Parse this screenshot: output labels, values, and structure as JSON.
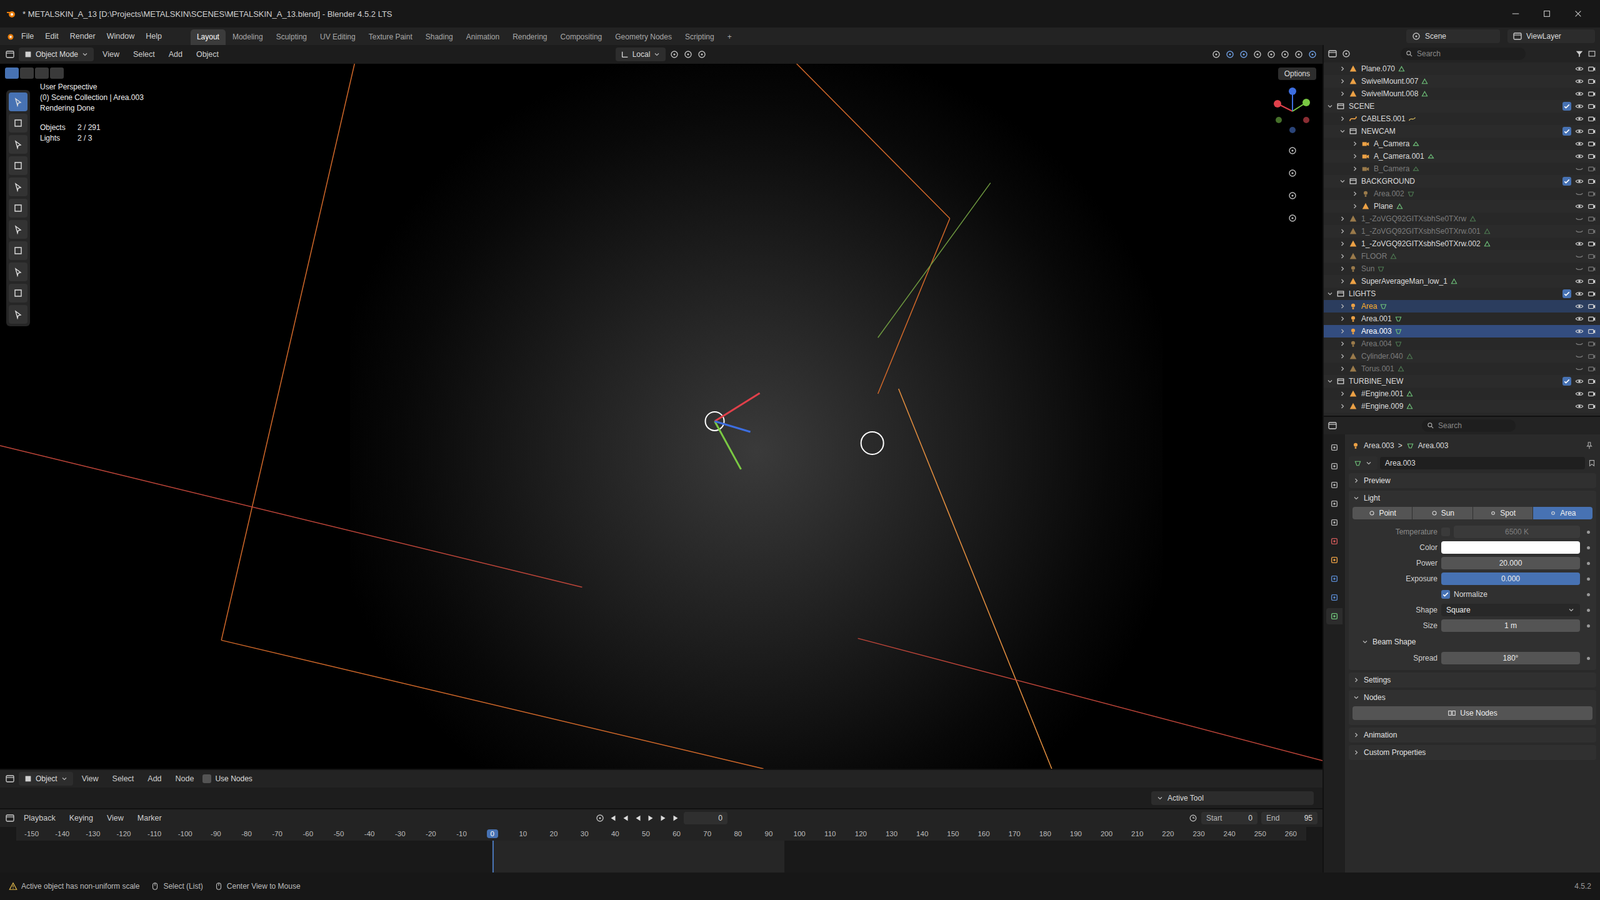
{
  "window": {
    "title": "* METALSKIN_A_13 [D:\\Projects\\METALSKIN\\SCENES\\METALSKIN_A_13.blend] - Blender 4.5.2 LTS"
  },
  "menu": [
    "File",
    "Edit",
    "Render",
    "Window",
    "Help"
  ],
  "workspaces": [
    {
      "label": "Layout",
      "selected": true
    },
    {
      "label": "Modeling",
      "selected": false
    },
    {
      "label": "Sculpting",
      "selected": false
    },
    {
      "label": "UV Editing",
      "selected": false
    },
    {
      "label": "Texture Paint",
      "selected": false
    },
    {
      "label": "Shading",
      "selected": false
    },
    {
      "label": "Animation",
      "selected": false
    },
    {
      "label": "Rendering",
      "selected": false
    },
    {
      "label": "Compositing",
      "selected": false
    },
    {
      "label": "Geometry Nodes",
      "selected": false
    },
    {
      "label": "Scripting",
      "selected": false
    }
  ],
  "add_workspace": "+",
  "scene": "Scene",
  "view_layer": "ViewLayer",
  "viewport": {
    "mode": "Object Mode",
    "menus": [
      "View",
      "Select",
      "Add",
      "Object"
    ],
    "transform_orientation": "Local",
    "options": "Options",
    "info": [
      "User Perspective",
      "(0) Scene Collection | Area.003",
      "Rendering Done"
    ],
    "stats": [
      {
        "label": "Objects",
        "value": "2 / 291"
      },
      {
        "label": "Lights",
        "value": "2 / 3"
      }
    ]
  },
  "outliner": {
    "search": "Search",
    "rows": [
      {
        "name": "Plane.070",
        "depth": 1,
        "kind": "mesh",
        "expanded": false,
        "visible": true,
        "selected": false,
        "active": false
      },
      {
        "name": "SwivelMount.007",
        "depth": 1,
        "kind": "mesh",
        "expanded": false,
        "visible": true,
        "selected": false,
        "active": false
      },
      {
        "name": "SwivelMount.008",
        "depth": 1,
        "kind": "mesh",
        "expanded": false,
        "visible": true,
        "selected": false,
        "active": false
      },
      {
        "name": "SCENE",
        "depth": 0,
        "kind": "collection",
        "expanded": true,
        "visible": true,
        "selected": false,
        "active": false
      },
      {
        "name": "CABLES.001",
        "depth": 1,
        "kind": "curve",
        "expanded": false,
        "visible": true,
        "selected": false,
        "active": false
      },
      {
        "name": "NEWCAM",
        "depth": 1,
        "kind": "collection",
        "expanded": true,
        "visible": true,
        "selected": false,
        "active": false
      },
      {
        "name": "A_Camera",
        "depth": 2,
        "kind": "camera",
        "expanded": false,
        "visible": true,
        "selected": false,
        "active": false
      },
      {
        "name": "A_Camera.001",
        "depth": 2,
        "kind": "camera",
        "expanded": false,
        "visible": true,
        "selected": false,
        "active": false
      },
      {
        "name": "B_Camera",
        "depth": 2,
        "kind": "camera",
        "expanded": false,
        "visible": false,
        "selected": false,
        "active": false
      },
      {
        "name": "BACKGROUND",
        "depth": 1,
        "kind": "collection",
        "expanded": true,
        "visible": true,
        "selected": false,
        "active": false
      },
      {
        "name": "Area.002",
        "depth": 2,
        "kind": "light",
        "expanded": false,
        "visible": false,
        "selected": false,
        "active": false
      },
      {
        "name": "Plane",
        "depth": 2,
        "kind": "mesh",
        "expanded": false,
        "visible": true,
        "selected": false,
        "active": false
      },
      {
        "name": "1_-ZoVGQ92GITXsbhSe0TXrw",
        "depth": 1,
        "kind": "mesh",
        "expanded": false,
        "visible": false,
        "selected": false,
        "active": false
      },
      {
        "name": "1_-ZoVGQ92GITXsbhSe0TXrw.001",
        "depth": 1,
        "kind": "mesh",
        "expanded": false,
        "visible": false,
        "selected": false,
        "active": false
      },
      {
        "name": "1_-ZoVGQ92GITXsbhSe0TXrw.002",
        "depth": 1,
        "kind": "mesh",
        "expanded": false,
        "visible": true,
        "selected": false,
        "active": false
      },
      {
        "name": "FLOOR",
        "depth": 1,
        "kind": "mesh",
        "expanded": false,
        "visible": false,
        "selected": false,
        "active": false
      },
      {
        "name": "Sun",
        "depth": 1,
        "kind": "light",
        "expanded": false,
        "visible": false,
        "selected": false,
        "active": false
      },
      {
        "name": "SuperAverageMan_low_1",
        "depth": 1,
        "kind": "mesh",
        "expanded": false,
        "visible": true,
        "selected": false,
        "active": false
      },
      {
        "name": "LIGHTS",
        "depth": 0,
        "kind": "collection",
        "expanded": true,
        "visible": true,
        "selected": false,
        "active": false
      },
      {
        "name": "Area",
        "depth": 1,
        "kind": "light",
        "expanded": false,
        "visible": true,
        "selected": true,
        "active": false
      },
      {
        "name": "Area.001",
        "depth": 1,
        "kind": "light",
        "expanded": false,
        "visible": true,
        "selected": false,
        "active": false
      },
      {
        "name": "Area.003",
        "depth": 1,
        "kind": "light",
        "expanded": false,
        "visible": true,
        "selected": true,
        "active": true
      },
      {
        "name": "Area.004",
        "depth": 1,
        "kind": "light",
        "expanded": false,
        "visible": false,
        "selected": false,
        "active": false
      },
      {
        "name": "Cylinder.040",
        "depth": 1,
        "kind": "mesh",
        "expanded": false,
        "visible": false,
        "selected": false,
        "active": false
      },
      {
        "name": "Torus.001",
        "depth": 1,
        "kind": "mesh",
        "expanded": false,
        "visible": false,
        "selected": false,
        "active": false
      },
      {
        "name": "TURBINE_NEW",
        "depth": 0,
        "kind": "collection",
        "expanded": true,
        "visible": true,
        "selected": false,
        "active": false
      },
      {
        "name": "#Engine.001",
        "depth": 1,
        "kind": "mesh",
        "expanded": false,
        "visible": true,
        "selected": false,
        "active": false
      },
      {
        "name": "#Engine.009",
        "depth": 1,
        "kind": "mesh",
        "expanded": false,
        "visible": true,
        "selected": false,
        "active": false
      }
    ]
  },
  "properties": {
    "search": "Search",
    "tabs": [
      {
        "kind": "tool",
        "selected": false
      },
      {
        "kind": "render",
        "selected": false
      },
      {
        "kind": "output",
        "selected": false
      },
      {
        "kind": "view_layer",
        "selected": false
      },
      {
        "kind": "scene",
        "selected": false
      },
      {
        "kind": "world",
        "selected": false
      },
      {
        "kind": "object",
        "selected": false
      },
      {
        "kind": "physics",
        "selected": false
      },
      {
        "kind": "constraints",
        "selected": false
      },
      {
        "kind": "data",
        "selected": true
      }
    ],
    "breadcrumb": [
      "Area.003",
      "Area.003"
    ],
    "separator": ">",
    "datablock": "Area.003",
    "panels": [
      {
        "title": "Preview",
        "expanded": false
      },
      {
        "title": "Light",
        "expanded": true,
        "types": [
          {
            "label": "Point",
            "selected": false
          },
          {
            "label": "Sun",
            "selected": false
          },
          {
            "label": "Spot",
            "selected": false
          },
          {
            "label": "Area",
            "selected": true
          }
        ],
        "fields": [
          {
            "kind": "slider",
            "label": "Temperature",
            "value": "6500 K",
            "disabled": true,
            "toggle": true,
            "checked": false,
            "level": 0
          },
          {
            "kind": "color",
            "label": "Color",
            "value": "#ffffff",
            "disabled": false
          },
          {
            "kind": "number",
            "label": "Power",
            "value": "20.000",
            "disabled": false
          },
          {
            "kind": "slider",
            "label": "Exposure",
            "value": "0.000",
            "disabled": false,
            "level": 1
          },
          {
            "kind": "checkbox",
            "label": "Normalize",
            "checked": true,
            "disabled": false
          },
          {
            "kind": "dropdown",
            "label": "Shape",
            "value": "Square",
            "disabled": false
          },
          {
            "kind": "number",
            "label": "Size",
            "value": "1 m",
            "disabled": false
          }
        ],
        "subpanels": [
          {
            "title": "Beam Shape",
            "expanded": true,
            "fields": [
              {
                "kind": "number",
                "label": "Spread",
                "value": "180°",
                "disabled": false
              }
            ]
          }
        ]
      },
      {
        "title": "Settings",
        "expanded": false
      },
      {
        "title": "Nodes",
        "expanded": true,
        "button": "Use Nodes"
      },
      {
        "title": "Animation",
        "expanded": false
      },
      {
        "title": "Custom Properties",
        "expanded": false
      }
    ]
  },
  "node_editor": {
    "mode": "Object",
    "menus": [
      "View",
      "Select",
      "Add",
      "Node"
    ],
    "use_nodes": {
      "label": "Use Nodes",
      "checked": false
    },
    "active_tool": {
      "label": "Active Tool",
      "expanded": true
    }
  },
  "timeline": {
    "menus": [
      "Playback",
      "Keying",
      "View",
      "Marker"
    ],
    "current_frame": "0",
    "start": {
      "label": "Start",
      "value": "0"
    },
    "end": {
      "label": "End",
      "value": "95"
    },
    "ruler": [
      {
        "label": "-150",
        "current": false
      },
      {
        "label": "-140",
        "current": false
      },
      {
        "label": "-130",
        "current": false
      },
      {
        "label": "-120",
        "current": false
      },
      {
        "label": "-110",
        "current": false
      },
      {
        "label": "-100",
        "current": false
      },
      {
        "label": "-90",
        "current": false
      },
      {
        "label": "-80",
        "current": false
      },
      {
        "label": "-70",
        "current": false
      },
      {
        "label": "-60",
        "current": false
      },
      {
        "label": "-50",
        "current": false
      },
      {
        "label": "-40",
        "current": false
      },
      {
        "label": "-30",
        "current": false
      },
      {
        "label": "-20",
        "current": false
      },
      {
        "label": "-10",
        "current": false
      },
      {
        "label": "0",
        "current": true
      },
      {
        "label": "10",
        "current": false
      },
      {
        "label": "20",
        "current": false
      },
      {
        "label": "30",
        "current": false
      },
      {
        "label": "40",
        "current": false
      },
      {
        "label": "50",
        "current": false
      },
      {
        "label": "60",
        "current": false
      },
      {
        "label": "70",
        "current": false
      },
      {
        "label": "80",
        "current": false
      },
      {
        "label": "90",
        "current": false
      },
      {
        "label": "100",
        "current": false
      },
      {
        "label": "110",
        "current": false
      },
      {
        "label": "120",
        "current": false
      },
      {
        "label": "130",
        "current": false
      },
      {
        "label": "140",
        "current": false
      },
      {
        "label": "150",
        "current": false
      },
      {
        "label": "160",
        "current": false
      },
      {
        "label": "170",
        "current": false
      },
      {
        "label": "180",
        "current": false
      },
      {
        "label": "190",
        "current": false
      },
      {
        "label": "200",
        "current": false
      },
      {
        "label": "210",
        "current": false
      },
      {
        "label": "220",
        "current": false
      },
      {
        "label": "230",
        "current": false
      },
      {
        "label": "240",
        "current": false
      },
      {
        "label": "250",
        "current": false
      },
      {
        "label": "260",
        "current": false
      }
    ]
  },
  "status_bar": {
    "items": [
      {
        "label": "Active object has non-uniform scale",
        "kind": "warning"
      },
      {
        "label": "Select (List)",
        "kind": "mouse"
      },
      {
        "label": "Center View to Mouse",
        "kind": "mouse"
      }
    ],
    "version": "4.5.2"
  }
}
